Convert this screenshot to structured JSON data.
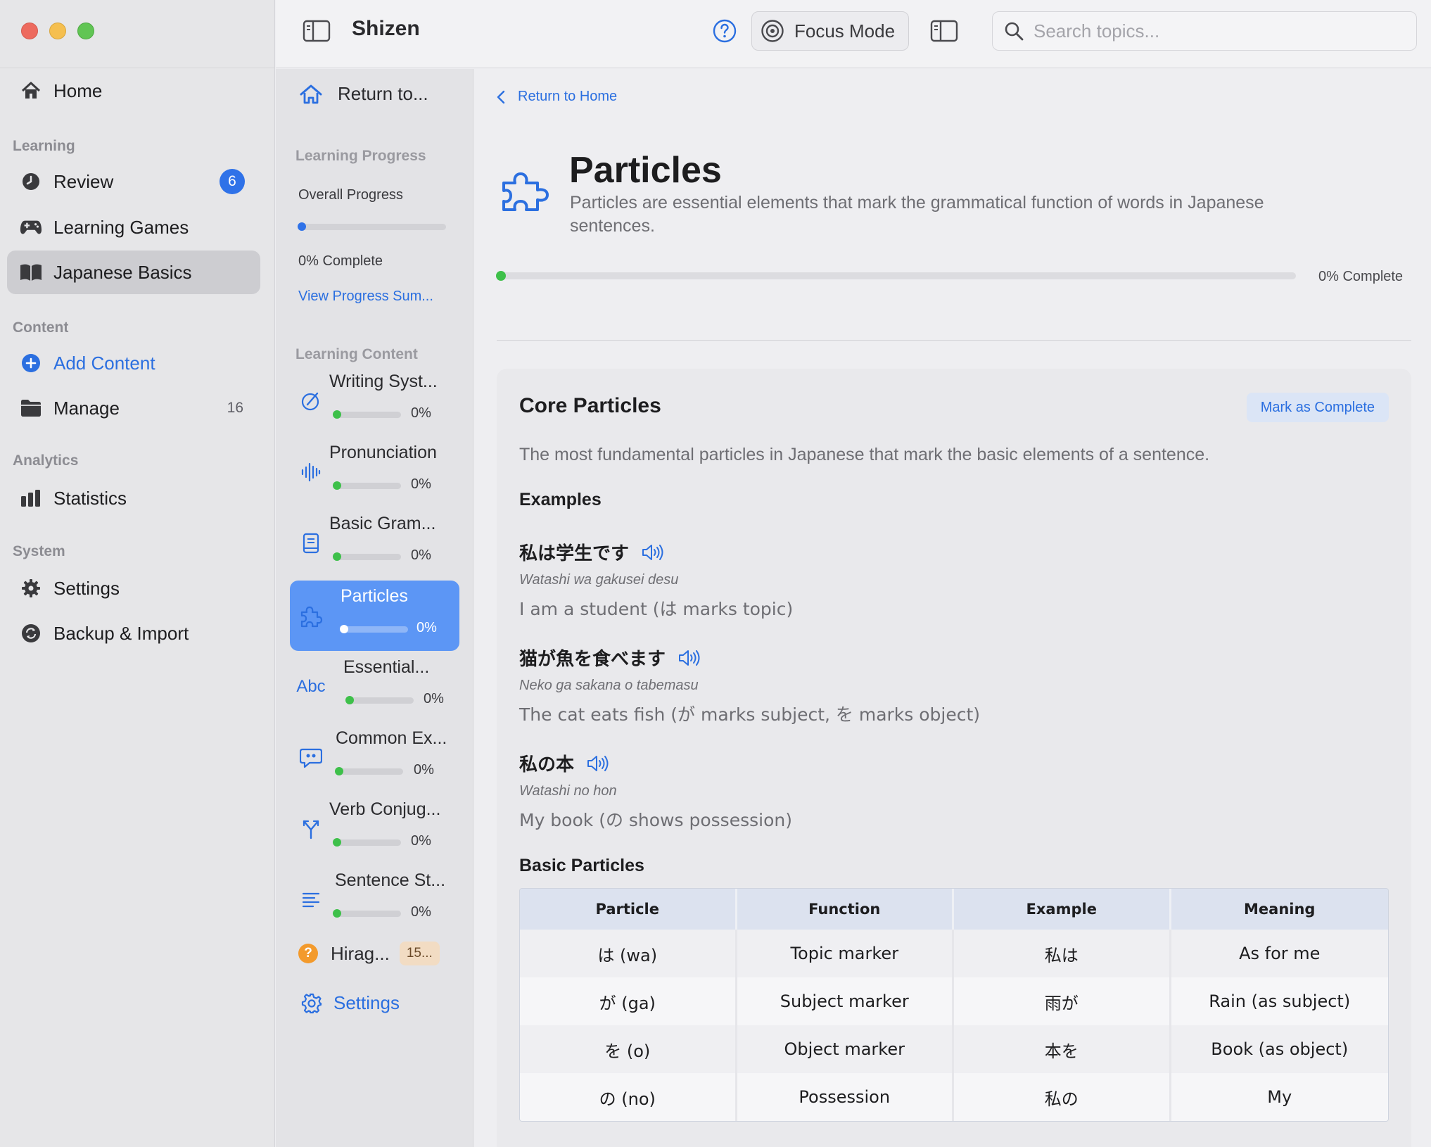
{
  "sidebar": {
    "home": "Home",
    "sections": {
      "learning": "Learning",
      "content": "Content",
      "analytics": "Analytics",
      "system": "System"
    },
    "review": {
      "label": "Review",
      "badge": "6"
    },
    "learning_games": "Learning Games",
    "japanese_basics": "Japanese Basics",
    "add_content": "Add Content",
    "manage": {
      "label": "Manage",
      "count": "16"
    },
    "statistics": "Statistics",
    "settings": "Settings",
    "backup_import": "Backup & Import"
  },
  "topbar": {
    "app_title": "Shizen",
    "focus_mode": "Focus Mode",
    "search_placeholder": "Search topics..."
  },
  "midcol": {
    "return_label": "Return to...",
    "learning_progress": "Learning Progress",
    "overall_progress": "Overall Progress",
    "overall_percent_text": "0% Complete",
    "overall_percent_value": 0,
    "view_summary": "View Progress Sum...",
    "learning_content": "Learning Content",
    "topics": [
      {
        "name": "Writing Syst...",
        "icon": "writing-icon",
        "percent": "0%"
      },
      {
        "name": "Pronunciation",
        "icon": "waveform-icon",
        "percent": "0%"
      },
      {
        "name": "Basic Gram...",
        "icon": "book-icon",
        "percent": "0%"
      },
      {
        "name": "Particles",
        "icon": "puzzle-icon",
        "percent": "0%"
      },
      {
        "name": "Essential...",
        "icon": "abc-icon",
        "percent": "0%"
      },
      {
        "name": "Common Ex...",
        "icon": "quote-bubble-icon",
        "percent": "0%"
      },
      {
        "name": "Verb Conjug...",
        "icon": "branch-icon",
        "percent": "0%"
      },
      {
        "name": "Sentence St...",
        "icon": "text-align-icon",
        "percent": "0%"
      }
    ],
    "abc_glyph": "Abc",
    "hiragana": {
      "label": "Hirag...",
      "badge": "15..."
    },
    "settings": "Settings"
  },
  "main": {
    "breadcrumb": "Return to Home",
    "title": "Particles",
    "description": "Particles are essential elements that mark the grammatical function of words in Japanese sentences.",
    "progress_text": "0% Complete",
    "progress_value": 0,
    "card": {
      "title": "Core Particles",
      "mark_complete": "Mark as Complete",
      "description": "The most fundamental particles in Japanese that mark the basic elements of a sentence.",
      "examples_heading": "Examples",
      "examples": [
        {
          "japanese": "私は学生です",
          "romaji": "Watashi wa gakusei desu",
          "meaning": "I am a student (は marks topic)"
        },
        {
          "japanese": "猫が魚を食べます",
          "romaji": "Neko ga sakana o tabemasu",
          "meaning": "The cat eats fish (が marks subject, を marks object)"
        },
        {
          "japanese": "私の本",
          "romaji": "Watashi no hon",
          "meaning": "My book (の shows possession)"
        }
      ],
      "table_heading": "Basic Particles",
      "table": {
        "headers": [
          "Particle",
          "Function",
          "Example",
          "Meaning"
        ],
        "rows": [
          [
            "は (wa)",
            "Topic marker",
            "私は",
            "As for me"
          ],
          [
            "が (ga)",
            "Subject marker",
            "雨が",
            "Rain (as subject)"
          ],
          [
            "を (o)",
            "Object marker",
            "本を",
            "Book (as object)"
          ],
          [
            "の (no)",
            "Possession",
            "私の",
            "My"
          ]
        ]
      }
    }
  },
  "colors": {
    "accent": "#2b6fe0",
    "active_topic": "#5c96f5",
    "progress_green": "#3ec04a",
    "badge_blue": "#2f72e8",
    "hiragana_orange": "#f39a2c"
  }
}
